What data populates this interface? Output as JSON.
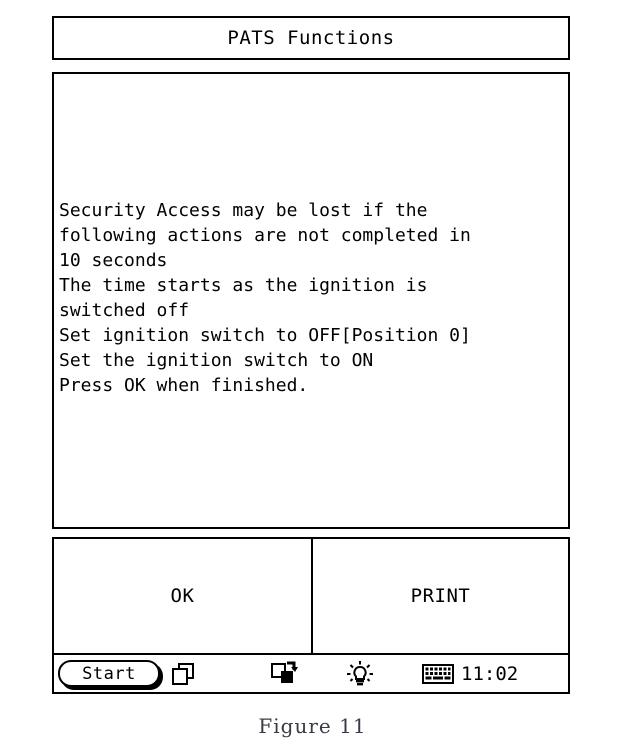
{
  "screen": {
    "title": "PATS Functions",
    "message_lines": [
      "Security Access may be lost if the",
      "following actions are not completed in",
      "10 seconds",
      "The time starts as the ignition is",
      "switched off",
      "Set ignition switch to OFF[Position 0]",
      "Set the ignition switch to ON",
      "Press OK when finished."
    ],
    "buttons": {
      "ok_label": "OK",
      "print_label": "PRINT"
    },
    "taskbar": {
      "start_label": "Start",
      "clock": "11:02",
      "icons": [
        "cascade-windows-icon",
        "rotate-screen-icon",
        "brightness-icon",
        "keyboard-icon"
      ]
    }
  },
  "caption": {
    "text": "Figure 11"
  },
  "colors": {
    "ink": "#000000",
    "background": "#ffffff",
    "caption_ink": "#3a3a46"
  }
}
